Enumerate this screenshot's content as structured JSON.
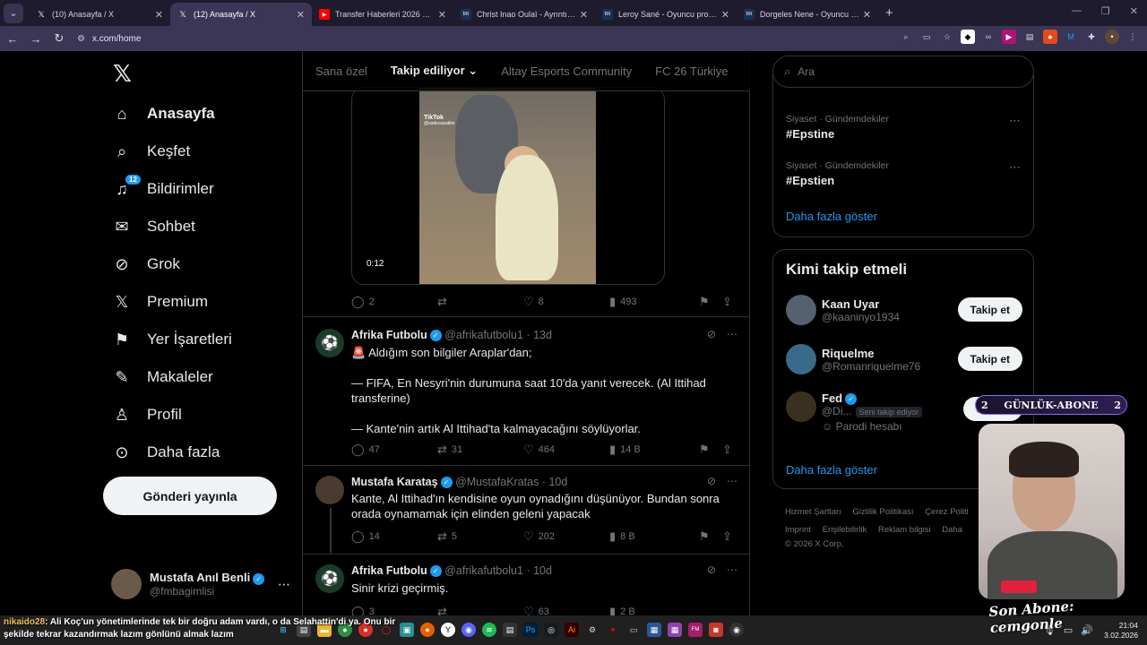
{
  "browser": {
    "tabs": [
      {
        "title": "(10) Anasayfa / X",
        "icon": "x-logo-icon",
        "active": false
      },
      {
        "title": "(12) Anasayfa / X",
        "icon": "x-logo-icon",
        "active": true
      },
      {
        "title": "Transfer Haberleri 2026 ⚽ Ma",
        "icon": "youtube-icon",
        "active": false
      },
      {
        "title": "Christ Inao Oulaï - Ayrıntılı perf",
        "icon": "transfermarkt-icon",
        "active": false
      },
      {
        "title": "Leroy Sané - Oyuncu profili 25/",
        "icon": "transfermarkt-icon",
        "active": false
      },
      {
        "title": "Dorgeles Nene - Oyuncu profili",
        "icon": "transfermarkt-icon",
        "active": false
      }
    ],
    "url": "x.com/home"
  },
  "sidebar": {
    "items": [
      {
        "label": "Anasayfa",
        "icon": "home-icon",
        "glyph": "⌂",
        "badge": ""
      },
      {
        "label": "Keşfet",
        "icon": "search-icon",
        "glyph": "⌕",
        "badge": ""
      },
      {
        "label": "Bildirimler",
        "icon": "bell-icon",
        "glyph": "🔔",
        "badge": "12"
      },
      {
        "label": "Sohbet",
        "icon": "mail-icon",
        "glyph": "✉",
        "badge": ""
      },
      {
        "label": "Grok",
        "icon": "grok-icon",
        "glyph": "⊘",
        "badge": ""
      },
      {
        "label": "Premium",
        "icon": "x-logo-icon",
        "glyph": "𝕏",
        "badge": ""
      },
      {
        "label": "Yer İşaretleri",
        "icon": "bookmark-icon",
        "glyph": "🔖",
        "badge": ""
      },
      {
        "label": "Makaleler",
        "icon": "article-icon",
        "glyph": "✎",
        "badge": ""
      },
      {
        "label": "Profil",
        "icon": "person-icon",
        "glyph": "👤",
        "badge": ""
      },
      {
        "label": "Daha fazla",
        "icon": "more-circle-icon",
        "glyph": "⋯",
        "badge": ""
      }
    ],
    "post_button": "Gönderi yayınla",
    "account": {
      "name": "Mustafa Anıl Benli",
      "handle": "@fmbagimlisi"
    }
  },
  "feed": {
    "tabs": [
      "Sana özel",
      "Takip ediliyor",
      "Altay Esports Community",
      "FC 26 Türkiye"
    ],
    "active_tab": "Takip ediliyor",
    "video": {
      "duration": "0:12",
      "watermark": "TikTok",
      "watermark_handle": "@sadecepatiler"
    },
    "first_post_actions": {
      "replies": "2",
      "reposts": "",
      "likes": "8",
      "views": "493"
    },
    "posts": [
      {
        "name": "Afrika Futbolu",
        "handle": "@afrikafutbolu1",
        "time": "13d",
        "text": "🚨 Aldığım son bilgiler Araplar'dan;\n\n— FIFA, En Nesyri'nin durumuna saat 10'da yanıt verecek. (Al Ittihad transferine)\n\n— Kante'nin artık Al Ittihad'ta kalmayacağını söylüyorlar.",
        "replies": "47",
        "reposts": "31",
        "likes": "464",
        "views": "14 B"
      },
      {
        "name": "Mustafa Karataş",
        "handle": "@MustafaKratas",
        "time": "10d",
        "text": "Kante, Al Ittihad'ın kendisine oyun oynadığını düşünüyor. Bundan sonra orada oynamamak için elinden geleni yapacak",
        "replies": "14",
        "reposts": "5",
        "likes": "202",
        "views": "8 B"
      },
      {
        "name": "Afrika Futbolu",
        "handle": "@afrikafutbolu1",
        "time": "10d",
        "text": "Sinir krizi geçirmiş.",
        "replies": "3",
        "reposts": "",
        "likes": "63",
        "views": "2 B"
      }
    ]
  },
  "right": {
    "search_placeholder": "Ara",
    "trends": [
      {
        "meta": "Siyaset · Gündemdekiler",
        "tag": "#Epstine"
      },
      {
        "meta": "Siyaset · Gündemdekiler",
        "tag": "#Epstien"
      }
    ],
    "show_more": "Daha fazla göster",
    "who_to_follow_title": "Kimi takip etmeli",
    "who_to_follow": [
      {
        "name": "Kaan Uyar",
        "handle": "@kaaninyo1934",
        "button": "Takip et",
        "follows_you": "",
        "extra": ""
      },
      {
        "name": "Riquelme",
        "handle": "@Romanriquelme76",
        "button": "Takip et",
        "follows_you": "",
        "extra": ""
      },
      {
        "name": "Fed",
        "handle": "@Di...",
        "button": "Geri ta",
        "follows_you": "Seni takip ediyor",
        "extra": "Parodi hesabı"
      }
    ],
    "show_more_2": "Daha fazla göster",
    "footer": [
      "Hizmet Şartları",
      "Gizlilik Politikası",
      "Çerez Politi",
      "Imprint",
      "Erişilebilirlik",
      "Reklam bilgisi",
      "Daha",
      "© 2026 X Corp."
    ]
  },
  "overlay": {
    "sub_goal_left": "2",
    "sub_goal_label": "GÜNLÜK-ABONE",
    "sub_goal_right": "2",
    "last_sub": "Son Abone: cemgonle",
    "chat_user": "nikaido28",
    "chat_text": ": Ali Koç'un yönetimlerinde tek bir doğru adam vardı, o da Selahattin'di ya. Onu bir şekilde tekrar kazandırmak lazım gönlünü almak lazım"
  },
  "taskbar": {
    "time": "21:04",
    "date": "3.02.2026"
  }
}
